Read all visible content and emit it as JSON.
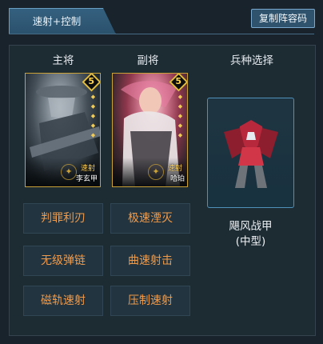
{
  "tab": {
    "label": "速射+控制"
  },
  "toolbar": {
    "copy_label": "复制阵容码"
  },
  "sections": {
    "main": "主将",
    "sub": "副将",
    "troop": "兵种选择"
  },
  "main_general": {
    "star": "5",
    "type": "速射",
    "name": "李玄甲",
    "emblem_icon": "crest-emblem"
  },
  "sub_general": {
    "star": "5",
    "type": "速射",
    "name": "哈珀",
    "emblem_icon": "crest-emblem"
  },
  "troop": {
    "name_line1": "飓风战甲",
    "name_line2": "(中型)"
  },
  "skills": [
    "判罪利刃",
    "极速湮灭",
    "无级弹链",
    "曲速射击",
    "磁轨速射",
    "压制速射"
  ],
  "colors": {
    "accent": "#f09b4c",
    "gold": "#c9a137",
    "panel": "#1d2b33",
    "tab": "#2f5877"
  }
}
